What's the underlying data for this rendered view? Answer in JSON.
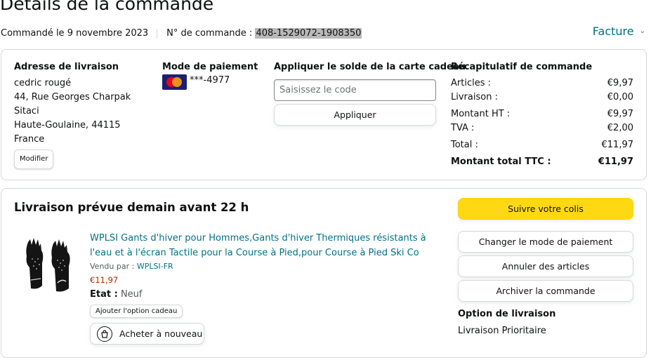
{
  "header": {
    "title": "Détails de la commande",
    "ordered_on": "Commandé le 9 novembre 2023",
    "order_number_label": "N° de commande :",
    "order_number": "408-1529072-1908350",
    "invoice_label": "Facture",
    "invoice_icon": "chevron-down-icon"
  },
  "shipping": {
    "heading": "Adresse de livraison",
    "lines": [
      "cedric rougé",
      "44, Rue Georges Charpak",
      "Sitaci",
      "Haute-Goulaine, 44115",
      "France"
    ],
    "modify_label": "Modifier"
  },
  "payment": {
    "heading": "Mode de paiement",
    "card_icon": "mastercard-icon",
    "card_digits": "***-4977"
  },
  "gift_card": {
    "heading": "Appliquer le solde de la carte cadeau",
    "placeholder": "Saisissez le code",
    "apply_label": "Appliquer"
  },
  "summary": {
    "heading": "Récapitulatif de commande",
    "rows": [
      {
        "label": "Articles :",
        "value": "€9,97"
      },
      {
        "label": "Livraison :",
        "value": "€0,00"
      },
      {
        "label": "Montant HT :",
        "value": "€9,97"
      },
      {
        "label": "TVA :",
        "value": "€2,00"
      },
      {
        "label": "Total :",
        "value": "€11,97"
      },
      {
        "label": "Montant total TTC :",
        "value": "€11,97"
      }
    ]
  },
  "delivery": {
    "title": "Livraison prévue demain avant 22 h",
    "product": {
      "title": "WPLSI Gants d'hiver pour Hommes,Gants d'hiver Thermiques résistants à l'eau et à l'écran Tactile pour la Course à Pied,pour Course à Pied Ski Co",
      "sold_by_label": "Vendu par :",
      "seller": "WPLSI-FR",
      "price": "€11,97",
      "condition_label": "Etat :",
      "condition_value": "Neuf",
      "gift_option_label": "Ajouter l'option cadeau",
      "buy_again_label": "Acheter à nouveau",
      "buy_again_icon": "reorder-icon",
      "image_icon": "gloves-product-image"
    },
    "actions": {
      "track": "Suivre votre colis",
      "change_payment": "Changer le mode de paiement",
      "cancel_items": "Annuler des articles",
      "archive": "Archiver la commande"
    },
    "option_heading": "Option de livraison",
    "option_value": "Livraison Prioritaire"
  },
  "colors": {
    "link": "#007185",
    "price": "#b12704",
    "track_button": "#ffd814",
    "border": "#d5d9d9"
  }
}
